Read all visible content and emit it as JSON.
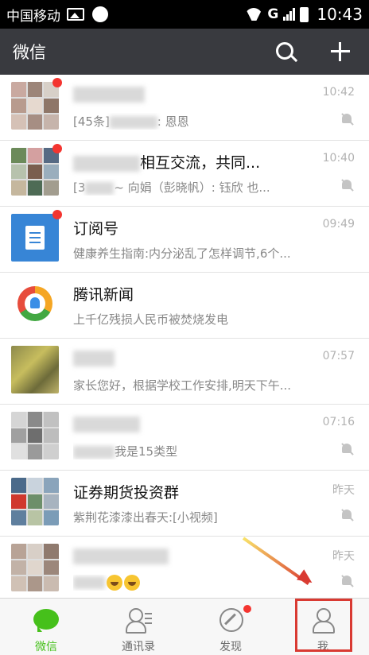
{
  "status_bar": {
    "carrier": "中国移动",
    "network": "G",
    "time": "10:43"
  },
  "header": {
    "title": "微信"
  },
  "chats": [
    {
      "name": "",
      "preview_prefix": "[45条]",
      "preview_suffix": ": 恩恩",
      "time": "10:42",
      "muted": true,
      "unread_dot": true
    },
    {
      "name": "相互交流，共同...",
      "preview_prefix": "[3",
      "preview_suffix": "~ 向娟（彭晓帆）: 钰欣 也...",
      "time": "10:40",
      "muted": true,
      "unread_dot": true
    },
    {
      "name": "订阅号",
      "preview": "健康养生指南:内分泌乱了怎样调节,6个...",
      "time": "09:49",
      "muted": false,
      "unread_dot": true
    },
    {
      "name": "腾讯新闻",
      "preview": "上千亿残损人民币被焚烧发电",
      "time": "",
      "muted": false,
      "unread_dot": false
    },
    {
      "name": "",
      "preview": "家长您好，根据学校工作安排,明天下午...",
      "time": "07:57",
      "muted": false,
      "unread_dot": false
    },
    {
      "name": "",
      "preview_suffix": "我是15类型",
      "time": "07:16",
      "muted": true,
      "unread_dot": false
    },
    {
      "name": "证券期货投资群",
      "preview": "紫荆花漆漆出春天:[小视频]",
      "time": "昨天",
      "muted": true,
      "unread_dot": false
    },
    {
      "name": "",
      "preview": "",
      "time": "昨天",
      "muted": true,
      "unread_dot": false
    }
  ],
  "tabs": [
    {
      "label": "微信",
      "icon": "chat-icon",
      "active": true
    },
    {
      "label": "通讯录",
      "icon": "contacts-icon",
      "active": false
    },
    {
      "label": "发现",
      "icon": "discover-icon",
      "active": false,
      "badge_dot": true
    },
    {
      "label": "我",
      "icon": "me-icon",
      "active": false
    }
  ],
  "colors": {
    "header_bg": "#393a3f",
    "accent_green": "#46c01b",
    "unread_red": "#f43530",
    "highlight_red": "#d93a32"
  }
}
